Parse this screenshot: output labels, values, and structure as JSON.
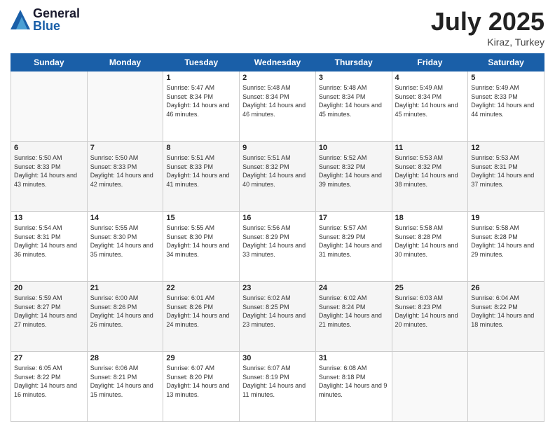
{
  "header": {
    "logo_general": "General",
    "logo_blue": "Blue",
    "title": "July 2025",
    "location": "Kiraz, Turkey"
  },
  "days_of_week": [
    "Sunday",
    "Monday",
    "Tuesday",
    "Wednesday",
    "Thursday",
    "Friday",
    "Saturday"
  ],
  "weeks": [
    [
      {
        "day": "",
        "sunrise": "",
        "sunset": "",
        "daylight": ""
      },
      {
        "day": "",
        "sunrise": "",
        "sunset": "",
        "daylight": ""
      },
      {
        "day": "1",
        "sunrise": "Sunrise: 5:47 AM",
        "sunset": "Sunset: 8:34 PM",
        "daylight": "Daylight: 14 hours and 46 minutes."
      },
      {
        "day": "2",
        "sunrise": "Sunrise: 5:48 AM",
        "sunset": "Sunset: 8:34 PM",
        "daylight": "Daylight: 14 hours and 46 minutes."
      },
      {
        "day": "3",
        "sunrise": "Sunrise: 5:48 AM",
        "sunset": "Sunset: 8:34 PM",
        "daylight": "Daylight: 14 hours and 45 minutes."
      },
      {
        "day": "4",
        "sunrise": "Sunrise: 5:49 AM",
        "sunset": "Sunset: 8:34 PM",
        "daylight": "Daylight: 14 hours and 45 minutes."
      },
      {
        "day": "5",
        "sunrise": "Sunrise: 5:49 AM",
        "sunset": "Sunset: 8:33 PM",
        "daylight": "Daylight: 14 hours and 44 minutes."
      }
    ],
    [
      {
        "day": "6",
        "sunrise": "Sunrise: 5:50 AM",
        "sunset": "Sunset: 8:33 PM",
        "daylight": "Daylight: 14 hours and 43 minutes."
      },
      {
        "day": "7",
        "sunrise": "Sunrise: 5:50 AM",
        "sunset": "Sunset: 8:33 PM",
        "daylight": "Daylight: 14 hours and 42 minutes."
      },
      {
        "day": "8",
        "sunrise": "Sunrise: 5:51 AM",
        "sunset": "Sunset: 8:33 PM",
        "daylight": "Daylight: 14 hours and 41 minutes."
      },
      {
        "day": "9",
        "sunrise": "Sunrise: 5:51 AM",
        "sunset": "Sunset: 8:32 PM",
        "daylight": "Daylight: 14 hours and 40 minutes."
      },
      {
        "day": "10",
        "sunrise": "Sunrise: 5:52 AM",
        "sunset": "Sunset: 8:32 PM",
        "daylight": "Daylight: 14 hours and 39 minutes."
      },
      {
        "day": "11",
        "sunrise": "Sunrise: 5:53 AM",
        "sunset": "Sunset: 8:32 PM",
        "daylight": "Daylight: 14 hours and 38 minutes."
      },
      {
        "day": "12",
        "sunrise": "Sunrise: 5:53 AM",
        "sunset": "Sunset: 8:31 PM",
        "daylight": "Daylight: 14 hours and 37 minutes."
      }
    ],
    [
      {
        "day": "13",
        "sunrise": "Sunrise: 5:54 AM",
        "sunset": "Sunset: 8:31 PM",
        "daylight": "Daylight: 14 hours and 36 minutes."
      },
      {
        "day": "14",
        "sunrise": "Sunrise: 5:55 AM",
        "sunset": "Sunset: 8:30 PM",
        "daylight": "Daylight: 14 hours and 35 minutes."
      },
      {
        "day": "15",
        "sunrise": "Sunrise: 5:55 AM",
        "sunset": "Sunset: 8:30 PM",
        "daylight": "Daylight: 14 hours and 34 minutes."
      },
      {
        "day": "16",
        "sunrise": "Sunrise: 5:56 AM",
        "sunset": "Sunset: 8:29 PM",
        "daylight": "Daylight: 14 hours and 33 minutes."
      },
      {
        "day": "17",
        "sunrise": "Sunrise: 5:57 AM",
        "sunset": "Sunset: 8:29 PM",
        "daylight": "Daylight: 14 hours and 31 minutes."
      },
      {
        "day": "18",
        "sunrise": "Sunrise: 5:58 AM",
        "sunset": "Sunset: 8:28 PM",
        "daylight": "Daylight: 14 hours and 30 minutes."
      },
      {
        "day": "19",
        "sunrise": "Sunrise: 5:58 AM",
        "sunset": "Sunset: 8:28 PM",
        "daylight": "Daylight: 14 hours and 29 minutes."
      }
    ],
    [
      {
        "day": "20",
        "sunrise": "Sunrise: 5:59 AM",
        "sunset": "Sunset: 8:27 PM",
        "daylight": "Daylight: 14 hours and 27 minutes."
      },
      {
        "day": "21",
        "sunrise": "Sunrise: 6:00 AM",
        "sunset": "Sunset: 8:26 PM",
        "daylight": "Daylight: 14 hours and 26 minutes."
      },
      {
        "day": "22",
        "sunrise": "Sunrise: 6:01 AM",
        "sunset": "Sunset: 8:26 PM",
        "daylight": "Daylight: 14 hours and 24 minutes."
      },
      {
        "day": "23",
        "sunrise": "Sunrise: 6:02 AM",
        "sunset": "Sunset: 8:25 PM",
        "daylight": "Daylight: 14 hours and 23 minutes."
      },
      {
        "day": "24",
        "sunrise": "Sunrise: 6:02 AM",
        "sunset": "Sunset: 8:24 PM",
        "daylight": "Daylight: 14 hours and 21 minutes."
      },
      {
        "day": "25",
        "sunrise": "Sunrise: 6:03 AM",
        "sunset": "Sunset: 8:23 PM",
        "daylight": "Daylight: 14 hours and 20 minutes."
      },
      {
        "day": "26",
        "sunrise": "Sunrise: 6:04 AM",
        "sunset": "Sunset: 8:22 PM",
        "daylight": "Daylight: 14 hours and 18 minutes."
      }
    ],
    [
      {
        "day": "27",
        "sunrise": "Sunrise: 6:05 AM",
        "sunset": "Sunset: 8:22 PM",
        "daylight": "Daylight: 14 hours and 16 minutes."
      },
      {
        "day": "28",
        "sunrise": "Sunrise: 6:06 AM",
        "sunset": "Sunset: 8:21 PM",
        "daylight": "Daylight: 14 hours and 15 minutes."
      },
      {
        "day": "29",
        "sunrise": "Sunrise: 6:07 AM",
        "sunset": "Sunset: 8:20 PM",
        "daylight": "Daylight: 14 hours and 13 minutes."
      },
      {
        "day": "30",
        "sunrise": "Sunrise: 6:07 AM",
        "sunset": "Sunset: 8:19 PM",
        "daylight": "Daylight: 14 hours and 11 minutes."
      },
      {
        "day": "31",
        "sunrise": "Sunrise: 6:08 AM",
        "sunset": "Sunset: 8:18 PM",
        "daylight": "Daylight: 14 hours and 9 minutes."
      },
      {
        "day": "",
        "sunrise": "",
        "sunset": "",
        "daylight": ""
      },
      {
        "day": "",
        "sunrise": "",
        "sunset": "",
        "daylight": ""
      }
    ]
  ]
}
